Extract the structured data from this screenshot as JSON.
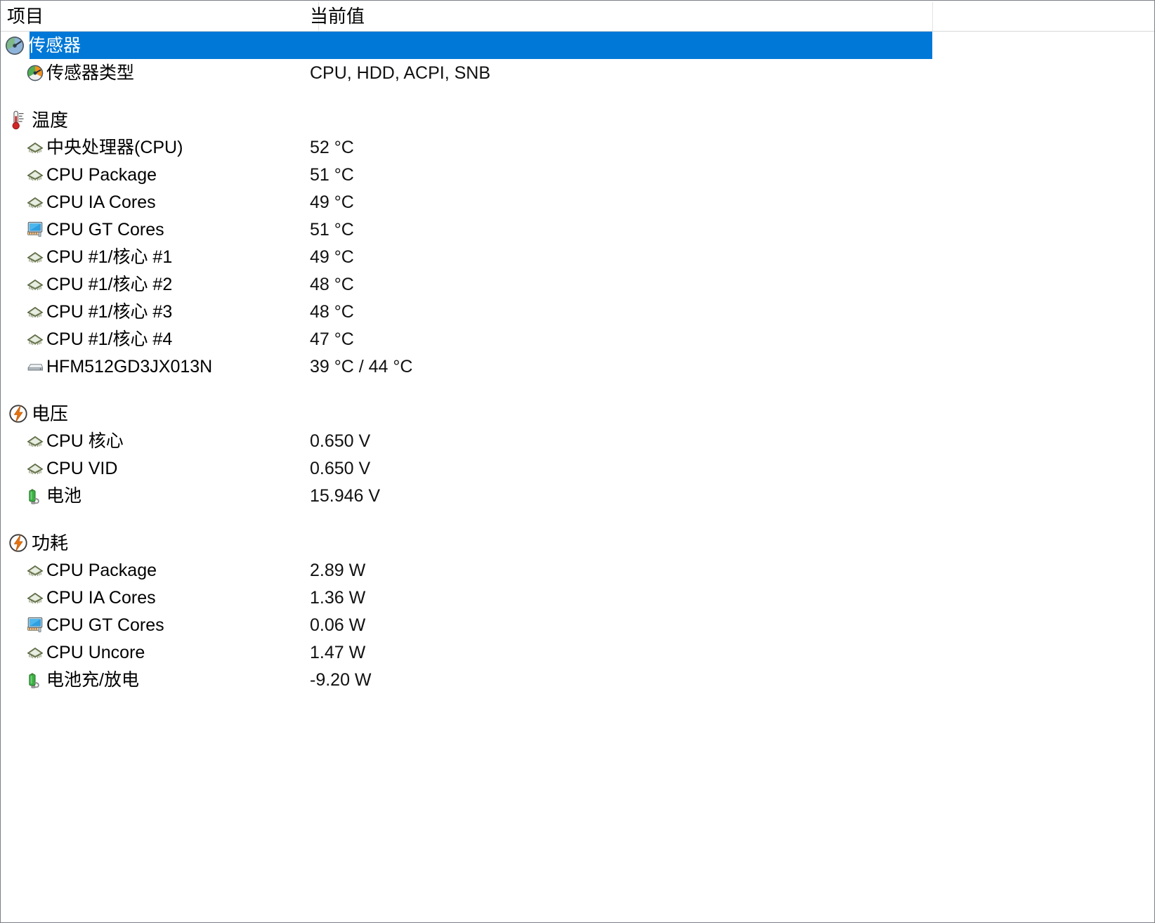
{
  "window": {
    "title": "传感器"
  },
  "columns": {
    "item": "项目",
    "value": "当前值"
  },
  "colors": {
    "selection": "#0078d7",
    "panel_border": "#7a7f87",
    "header_divider": "#e2e2e2",
    "cpu_icon": "#4b5a32",
    "gpu_icon": "#2f9fe0",
    "battery_icon": "#3cb043",
    "bolt_icon": "#e8730c",
    "thermo_icon": "#cc2020"
  },
  "rows": [
    {
      "kind": "root",
      "icon": "sensor-gauge-icon",
      "label": "传感器",
      "value": "",
      "selected": true
    },
    {
      "kind": "child",
      "icon": "sensor-type-gauge-icon",
      "label": "传感器类型",
      "value": "CPU, HDD, ACPI, SNB",
      "selected": false
    },
    {
      "kind": "spacer",
      "icon": "",
      "label": "",
      "value": "",
      "selected": false
    },
    {
      "kind": "group",
      "icon": "thermometer-icon",
      "label": "温度",
      "value": "",
      "selected": false
    },
    {
      "kind": "child",
      "icon": "cpu-chip-icon",
      "label": "中央处理器(CPU)",
      "value": "52 °C",
      "selected": false
    },
    {
      "kind": "child",
      "icon": "cpu-chip-icon",
      "label": "CPU Package",
      "value": "51 °C",
      "selected": false
    },
    {
      "kind": "child",
      "icon": "cpu-chip-icon",
      "label": "CPU IA Cores",
      "value": "49 °C",
      "selected": false
    },
    {
      "kind": "child",
      "icon": "gpu-monitor-icon",
      "label": "CPU GT Cores",
      "value": "51 °C",
      "selected": false
    },
    {
      "kind": "child",
      "icon": "cpu-chip-icon",
      "label": "CPU #1/核心 #1",
      "value": "49 °C",
      "selected": false
    },
    {
      "kind": "child",
      "icon": "cpu-chip-icon",
      "label": "CPU #1/核心 #2",
      "value": "48 °C",
      "selected": false
    },
    {
      "kind": "child",
      "icon": "cpu-chip-icon",
      "label": "CPU #1/核心 #3",
      "value": "48 °C",
      "selected": false
    },
    {
      "kind": "child",
      "icon": "cpu-chip-icon",
      "label": "CPU #1/核心 #4",
      "value": "47 °C",
      "selected": false
    },
    {
      "kind": "child",
      "icon": "hard-disk-icon",
      "label": "HFM512GD3JX013N",
      "value": "39 °C / 44 °C",
      "selected": false
    },
    {
      "kind": "spacer",
      "icon": "",
      "label": "",
      "value": "",
      "selected": false
    },
    {
      "kind": "group",
      "icon": "voltage-bolt-icon",
      "label": "电压",
      "value": "",
      "selected": false
    },
    {
      "kind": "child",
      "icon": "cpu-chip-icon",
      "label": "CPU 核心",
      "value": "0.650 V",
      "selected": false
    },
    {
      "kind": "child",
      "icon": "cpu-chip-icon",
      "label": "CPU VID",
      "value": "0.650 V",
      "selected": false
    },
    {
      "kind": "child",
      "icon": "battery-icon",
      "label": "电池",
      "value": "15.946 V",
      "selected": false
    },
    {
      "kind": "spacer",
      "icon": "",
      "label": "",
      "value": "",
      "selected": false
    },
    {
      "kind": "group",
      "icon": "power-bolt-icon",
      "label": "功耗",
      "value": "",
      "selected": false
    },
    {
      "kind": "child",
      "icon": "cpu-chip-icon",
      "label": "CPU Package",
      "value": "2.89 W",
      "selected": false
    },
    {
      "kind": "child",
      "icon": "cpu-chip-icon",
      "label": "CPU IA Cores",
      "value": "1.36 W",
      "selected": false
    },
    {
      "kind": "child",
      "icon": "gpu-monitor-icon",
      "label": "CPU GT Cores",
      "value": "0.06 W",
      "selected": false
    },
    {
      "kind": "child",
      "icon": "cpu-chip-icon",
      "label": "CPU Uncore",
      "value": "1.47 W",
      "selected": false
    },
    {
      "kind": "child",
      "icon": "battery-icon",
      "label": "电池充/放电",
      "value": "-9.20 W",
      "selected": false
    }
  ]
}
